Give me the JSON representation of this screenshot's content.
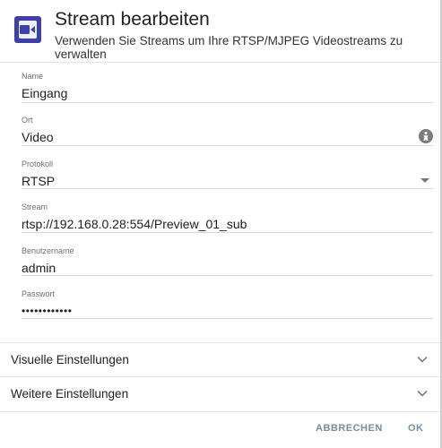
{
  "dialog": {
    "title": "Stream bearbeiten",
    "subtitle": "Verwenden Sie Streams um Ihre RTSP/MJPEG Videostreams zu verwalten",
    "icon": "video-camera-icon"
  },
  "form": {
    "name": {
      "label": "Name",
      "value": "Eingang"
    },
    "ort": {
      "label": "Ort",
      "value": "Video",
      "icon": "info-icon"
    },
    "protokoll": {
      "label": "Protokoll",
      "value": "RTSP",
      "icon": "dropdown-arrow-icon"
    },
    "stream": {
      "label": "Stream",
      "value": "rtsp://192.168.0.28:554/Preview_01_sub"
    },
    "benutzername": {
      "label": "Benutzername",
      "value": "admin"
    },
    "passwort": {
      "label": "Passwort",
      "value": "••••••••••••"
    }
  },
  "sections": [
    {
      "label": "Visuelle Einstellungen",
      "icon": "chevron-down-icon"
    },
    {
      "label": "Weitere Einstellungen",
      "icon": "chevron-down-icon"
    }
  ],
  "actions": {
    "cancel": "ABBRECHEN",
    "ok": "OK"
  },
  "colors": {
    "accent": "#3f3fa8",
    "button_text": "#7a8aa0"
  }
}
